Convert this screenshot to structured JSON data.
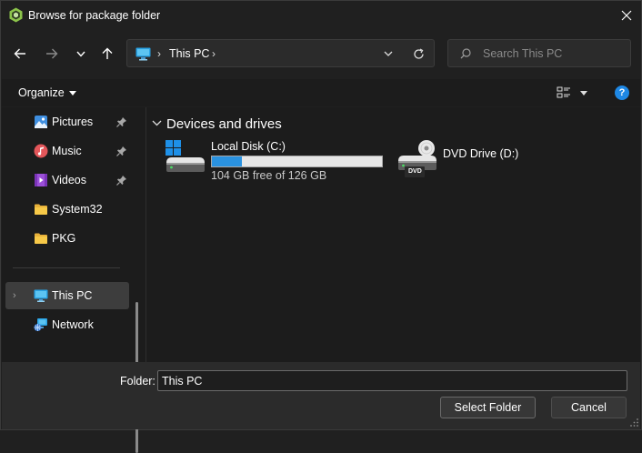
{
  "window": {
    "title": "Browse for package folder",
    "app_icon": "app-hexagon-icon",
    "accent_color": "#2a92e0"
  },
  "nav": {
    "back": "arrow-left-icon",
    "forward": "arrow-right-icon",
    "recent": "chevron-down-icon",
    "up": "arrow-up-icon"
  },
  "address": {
    "location": "This PC",
    "chevron": "›"
  },
  "search": {
    "placeholder": "Search This PC"
  },
  "commandbar": {
    "organize_label": "Organize",
    "help_label": "?"
  },
  "sidebar": {
    "items": [
      {
        "label": "Pictures",
        "icon": "pictures-icon",
        "pinned": true
      },
      {
        "label": "Music",
        "icon": "music-icon",
        "pinned": true
      },
      {
        "label": "Videos",
        "icon": "videos-icon",
        "pinned": true
      },
      {
        "label": "System32",
        "icon": "folder-icon",
        "pinned": false
      },
      {
        "label": "PKG",
        "icon": "folder-icon",
        "pinned": false
      },
      {
        "label": "This PC",
        "icon": "monitor-icon",
        "selected": true,
        "expandable": true,
        "expand_glyph": "›"
      },
      {
        "label": "Network",
        "icon": "network-icon"
      }
    ]
  },
  "main": {
    "group_title": "Devices and drives",
    "drives": [
      {
        "name": "Local Disk (C:)",
        "free_text": "104 GB free of 126 GB",
        "used_fraction": 0.175,
        "icon": "windows-drive-icon"
      },
      {
        "name": "DVD Drive (D:)",
        "icon": "dvd-drive-icon",
        "icon_label": "DVD"
      }
    ]
  },
  "footer": {
    "folder_label": "Folder:",
    "folder_value": "This PC",
    "select_label": "Select Folder",
    "cancel_label": "Cancel"
  }
}
